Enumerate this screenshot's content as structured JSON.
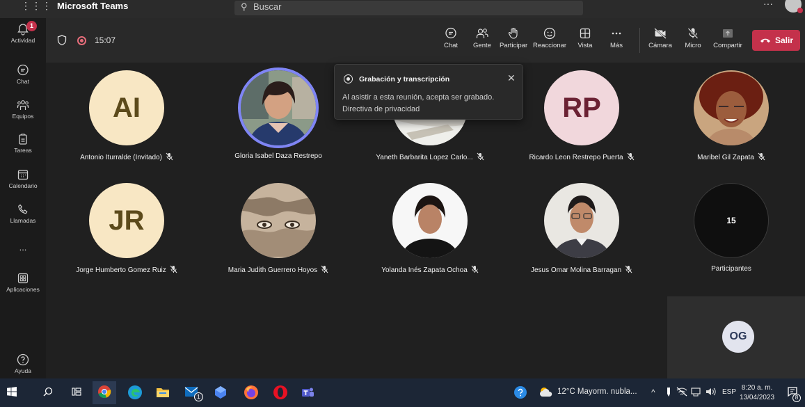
{
  "titlebar": {
    "app_title": "Microsoft Teams",
    "search_placeholder": "Buscar"
  },
  "rail": {
    "items": [
      {
        "label": "Actividad",
        "badge": "1"
      },
      {
        "label": "Chat"
      },
      {
        "label": "Equipos"
      },
      {
        "label": "Tareas"
      },
      {
        "label": "Calendario"
      },
      {
        "label": "Llamadas"
      },
      {
        "label": "..."
      },
      {
        "label": "Aplicaciones"
      },
      {
        "label": "Ayuda"
      }
    ]
  },
  "meeting": {
    "timer": "15:07",
    "toolbar": {
      "chat": "Chat",
      "people": "Gente",
      "raise": "Participar",
      "react": "Reaccionar",
      "view": "Vista",
      "more": "Más",
      "camera": "Cámara",
      "mic": "Micro",
      "share": "Compartir",
      "leave": "Salir"
    },
    "popup": {
      "title": "Grabación y transcripción",
      "line1": "Al asistir a esta reunión, acepta ser grabado.",
      "line2": "Directiva de privacidad"
    },
    "participants": [
      {
        "name": "Antonio Iturralde (Invitado)",
        "initials": "AI",
        "muted": true
      },
      {
        "name": "Gloria Isabel Daza Restrepo",
        "muted": false
      },
      {
        "name": "Yaneth Barbarita Lopez Carlo...",
        "muted": true
      },
      {
        "name": "Ricardo Leon Restrepo Puerta",
        "initials": "RP",
        "muted": true
      },
      {
        "name": "Maribel Gil Zapata",
        "muted": true
      },
      {
        "name": "Jorge Humberto Gomez Ruiz",
        "initials": "JR",
        "muted": true
      },
      {
        "name": "Maria Judith Guerrero Hoyos",
        "muted": true
      },
      {
        "name": "Yolanda Inés Zapata Ochoa",
        "muted": true
      },
      {
        "name": "Jesus Omar Molina Barragan",
        "muted": true
      }
    ],
    "overflow": {
      "count": "15",
      "label": "Participantes"
    },
    "self_view": {
      "initials": "OG"
    }
  },
  "taskbar": {
    "weather": "12°C  Mayorm. nubla...",
    "language": "ESP",
    "time": "8:20 a. m.",
    "date": "13/04/2023",
    "mail_badge": "1",
    "notification_count": "8"
  }
}
